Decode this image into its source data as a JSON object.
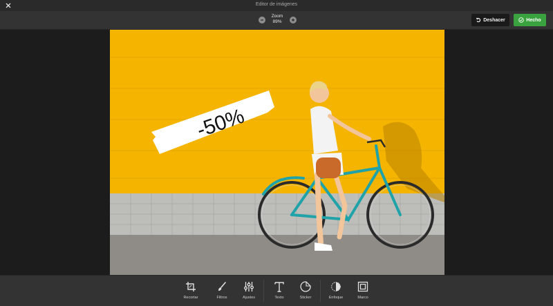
{
  "window": {
    "title": "Editor de imágenes"
  },
  "zoom": {
    "label": "Zoom",
    "value": "89%"
  },
  "actions": {
    "undo_label": "Deshacer",
    "done_label": "Hecho"
  },
  "image": {
    "sticker_text": "-50%"
  },
  "tools": [
    {
      "label": "Recortar",
      "icon": "crop-icon"
    },
    {
      "label": "Filtros",
      "icon": "brush-icon"
    },
    {
      "label": "Ajustes",
      "icon": "sliders-icon"
    },
    {
      "label": "Texto",
      "icon": "text-icon"
    },
    {
      "label": "Sticker",
      "icon": "sticker-icon"
    },
    {
      "label": "Enfoque",
      "icon": "focus-icon"
    },
    {
      "label": "Marco",
      "icon": "frame-icon"
    }
  ],
  "colors": {
    "accent": "#3aa33f",
    "panel": "#333333",
    "background": "#1c1c1c",
    "wall": "#f4b400",
    "bike": "#1fa3a8"
  }
}
